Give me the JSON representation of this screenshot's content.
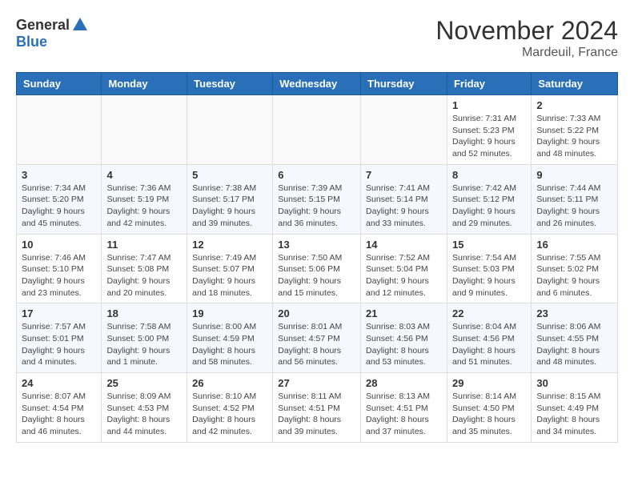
{
  "logo": {
    "general": "General",
    "blue": "Blue"
  },
  "header": {
    "month": "November 2024",
    "location": "Mardeuil, France"
  },
  "weekdays": [
    "Sunday",
    "Monday",
    "Tuesday",
    "Wednesday",
    "Thursday",
    "Friday",
    "Saturday"
  ],
  "weeks": [
    [
      {
        "day": "",
        "info": ""
      },
      {
        "day": "",
        "info": ""
      },
      {
        "day": "",
        "info": ""
      },
      {
        "day": "",
        "info": ""
      },
      {
        "day": "",
        "info": ""
      },
      {
        "day": "1",
        "info": "Sunrise: 7:31 AM\nSunset: 5:23 PM\nDaylight: 9 hours and 52 minutes."
      },
      {
        "day": "2",
        "info": "Sunrise: 7:33 AM\nSunset: 5:22 PM\nDaylight: 9 hours and 48 minutes."
      }
    ],
    [
      {
        "day": "3",
        "info": "Sunrise: 7:34 AM\nSunset: 5:20 PM\nDaylight: 9 hours and 45 minutes."
      },
      {
        "day": "4",
        "info": "Sunrise: 7:36 AM\nSunset: 5:19 PM\nDaylight: 9 hours and 42 minutes."
      },
      {
        "day": "5",
        "info": "Sunrise: 7:38 AM\nSunset: 5:17 PM\nDaylight: 9 hours and 39 minutes."
      },
      {
        "day": "6",
        "info": "Sunrise: 7:39 AM\nSunset: 5:15 PM\nDaylight: 9 hours and 36 minutes."
      },
      {
        "day": "7",
        "info": "Sunrise: 7:41 AM\nSunset: 5:14 PM\nDaylight: 9 hours and 33 minutes."
      },
      {
        "day": "8",
        "info": "Sunrise: 7:42 AM\nSunset: 5:12 PM\nDaylight: 9 hours and 29 minutes."
      },
      {
        "day": "9",
        "info": "Sunrise: 7:44 AM\nSunset: 5:11 PM\nDaylight: 9 hours and 26 minutes."
      }
    ],
    [
      {
        "day": "10",
        "info": "Sunrise: 7:46 AM\nSunset: 5:10 PM\nDaylight: 9 hours and 23 minutes."
      },
      {
        "day": "11",
        "info": "Sunrise: 7:47 AM\nSunset: 5:08 PM\nDaylight: 9 hours and 20 minutes."
      },
      {
        "day": "12",
        "info": "Sunrise: 7:49 AM\nSunset: 5:07 PM\nDaylight: 9 hours and 18 minutes."
      },
      {
        "day": "13",
        "info": "Sunrise: 7:50 AM\nSunset: 5:06 PM\nDaylight: 9 hours and 15 minutes."
      },
      {
        "day": "14",
        "info": "Sunrise: 7:52 AM\nSunset: 5:04 PM\nDaylight: 9 hours and 12 minutes."
      },
      {
        "day": "15",
        "info": "Sunrise: 7:54 AM\nSunset: 5:03 PM\nDaylight: 9 hours and 9 minutes."
      },
      {
        "day": "16",
        "info": "Sunrise: 7:55 AM\nSunset: 5:02 PM\nDaylight: 9 hours and 6 minutes."
      }
    ],
    [
      {
        "day": "17",
        "info": "Sunrise: 7:57 AM\nSunset: 5:01 PM\nDaylight: 9 hours and 4 minutes."
      },
      {
        "day": "18",
        "info": "Sunrise: 7:58 AM\nSunset: 5:00 PM\nDaylight: 9 hours and 1 minute."
      },
      {
        "day": "19",
        "info": "Sunrise: 8:00 AM\nSunset: 4:59 PM\nDaylight: 8 hours and 58 minutes."
      },
      {
        "day": "20",
        "info": "Sunrise: 8:01 AM\nSunset: 4:57 PM\nDaylight: 8 hours and 56 minutes."
      },
      {
        "day": "21",
        "info": "Sunrise: 8:03 AM\nSunset: 4:56 PM\nDaylight: 8 hours and 53 minutes."
      },
      {
        "day": "22",
        "info": "Sunrise: 8:04 AM\nSunset: 4:56 PM\nDaylight: 8 hours and 51 minutes."
      },
      {
        "day": "23",
        "info": "Sunrise: 8:06 AM\nSunset: 4:55 PM\nDaylight: 8 hours and 48 minutes."
      }
    ],
    [
      {
        "day": "24",
        "info": "Sunrise: 8:07 AM\nSunset: 4:54 PM\nDaylight: 8 hours and 46 minutes."
      },
      {
        "day": "25",
        "info": "Sunrise: 8:09 AM\nSunset: 4:53 PM\nDaylight: 8 hours and 44 minutes."
      },
      {
        "day": "26",
        "info": "Sunrise: 8:10 AM\nSunset: 4:52 PM\nDaylight: 8 hours and 42 minutes."
      },
      {
        "day": "27",
        "info": "Sunrise: 8:11 AM\nSunset: 4:51 PM\nDaylight: 8 hours and 39 minutes."
      },
      {
        "day": "28",
        "info": "Sunrise: 8:13 AM\nSunset: 4:51 PM\nDaylight: 8 hours and 37 minutes."
      },
      {
        "day": "29",
        "info": "Sunrise: 8:14 AM\nSunset: 4:50 PM\nDaylight: 8 hours and 35 minutes."
      },
      {
        "day": "30",
        "info": "Sunrise: 8:15 AM\nSunset: 4:49 PM\nDaylight: 8 hours and 34 minutes."
      }
    ]
  ]
}
